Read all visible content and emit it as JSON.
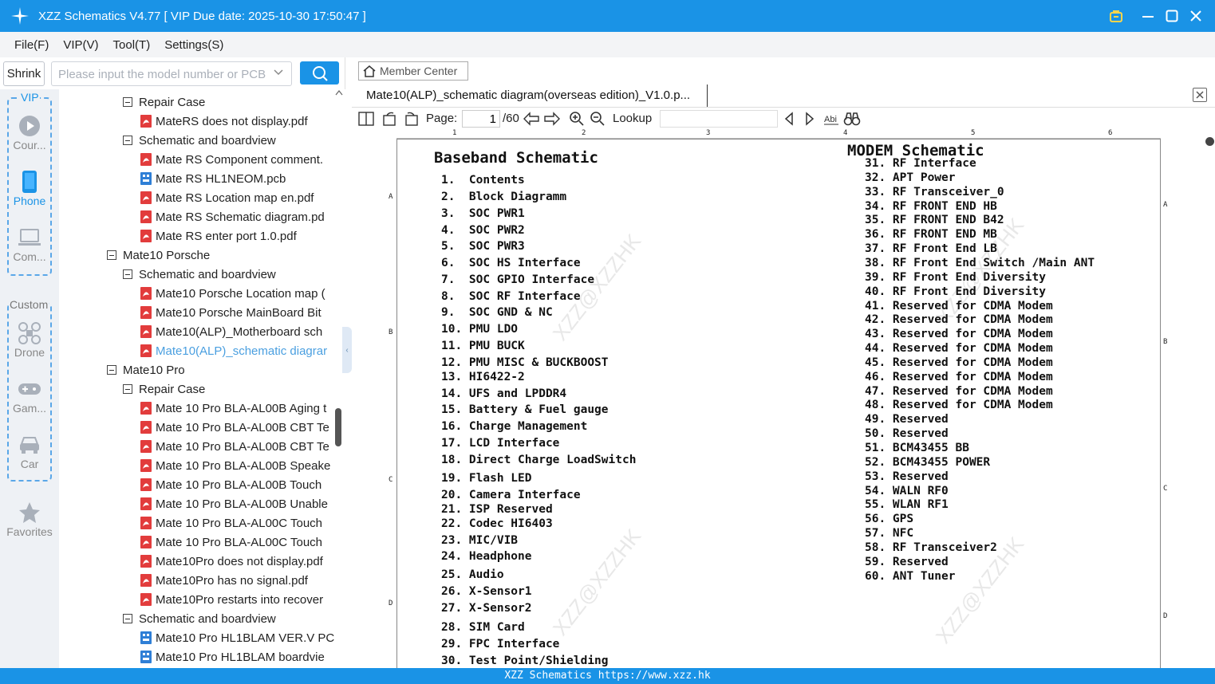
{
  "window": {
    "title": "XZZ Schematics V4.77 [ VIP Due date: 2025-10-30 17:50:47 ]"
  },
  "menu": [
    "File(F)",
    "VIP(V)",
    "Tool(T)",
    "Settings(S)"
  ],
  "left": {
    "shrink_label": "Shrink",
    "search_placeholder": "Please input the model number or PCB",
    "vip_label": "VIP",
    "custom_label": "Custom",
    "categories": [
      {
        "label": "Cour...",
        "icon": "play-icon"
      },
      {
        "label": "Phone",
        "icon": "phone-icon"
      },
      {
        "label": "Com...",
        "icon": "laptop-icon"
      },
      {
        "label": "Drone",
        "icon": "drone-icon"
      },
      {
        "label": "Gam...",
        "icon": "gamepad-icon"
      },
      {
        "label": "Car",
        "icon": "car-icon"
      },
      {
        "label": "Favorites",
        "icon": "star-icon"
      }
    ],
    "tree": [
      {
        "label": "Repair Case",
        "type": "folder",
        "level": 2
      },
      {
        "label": "MateRS does not display.pdf",
        "type": "pdf",
        "level": 3
      },
      {
        "label": "Schematic and boardview",
        "type": "folder",
        "level": 2
      },
      {
        "label": "Mate RS Component comment.",
        "type": "pdf",
        "level": 3
      },
      {
        "label": "Mate RS HL1NEOM.pcb",
        "type": "pcb",
        "level": 3
      },
      {
        "label": "Mate RS Location map en.pdf",
        "type": "pdf",
        "level": 3
      },
      {
        "label": "Mate RS Schematic diagram.pd",
        "type": "pdf",
        "level": 3
      },
      {
        "label": "Mate RS enter port 1.0.pdf",
        "type": "pdf",
        "level": 3
      },
      {
        "label": "Mate10 Porsche",
        "type": "folder",
        "level": 1
      },
      {
        "label": "Schematic and boardview",
        "type": "folder",
        "level": 2
      },
      {
        "label": "Mate10 Porsche Location map (",
        "type": "pdf",
        "level": 3
      },
      {
        "label": "Mate10 Porsche MainBoard Bit",
        "type": "pdf",
        "level": 3
      },
      {
        "label": "Mate10(ALP)_Motherboard sch",
        "type": "pdf",
        "level": 3
      },
      {
        "label": "Mate10(ALP)_schematic diagrar",
        "type": "pdf",
        "level": 3,
        "selected": true
      },
      {
        "label": "Mate10 Pro",
        "type": "folder",
        "level": 1
      },
      {
        "label": "Repair Case",
        "type": "folder",
        "level": 2
      },
      {
        "label": "Mate 10 Pro BLA-AL00B Aging t",
        "type": "pdf",
        "level": 3
      },
      {
        "label": "Mate 10 Pro BLA-AL00B CBT Te",
        "type": "pdf",
        "level": 3
      },
      {
        "label": "Mate 10 Pro BLA-AL00B CBT Te",
        "type": "pdf",
        "level": 3
      },
      {
        "label": "Mate 10 Pro BLA-AL00B Speake",
        "type": "pdf",
        "level": 3
      },
      {
        "label": "Mate 10 Pro BLA-AL00B Touch",
        "type": "pdf",
        "level": 3
      },
      {
        "label": "Mate 10 Pro BLA-AL00B Unable",
        "type": "pdf",
        "level": 3
      },
      {
        "label": "Mate 10 Pro BLA-AL00C Touch",
        "type": "pdf",
        "level": 3
      },
      {
        "label": "Mate 10 Pro BLA-AL00C Touch",
        "type": "pdf",
        "level": 3
      },
      {
        "label": "Mate10Pro does not display.pdf",
        "type": "pdf",
        "level": 3
      },
      {
        "label": "Mate10Pro has no signal.pdf",
        "type": "pdf",
        "level": 3
      },
      {
        "label": "Mate10Pro restarts into recover",
        "type": "pdf",
        "level": 3
      },
      {
        "label": "Schematic and boardview",
        "type": "folder",
        "level": 2
      },
      {
        "label": "Mate10 Pro HL1BLAM VER.V PC",
        "type": "pcb",
        "level": 3
      },
      {
        "label": "Mate10 Pro HL1BLAM boardvie",
        "type": "pcb",
        "level": 3
      }
    ]
  },
  "viewer": {
    "member_center": "Member Center",
    "tab_title": "Mate10(ALP)_schematic diagram(overseas edition)_V1.0.p...",
    "page_label": "Page:",
    "page_current": "1",
    "page_total": "/60",
    "lookup_label": "Lookup",
    "lookup_value": "",
    "ruler_cols": [
      "1",
      "2",
      "3",
      "4",
      "5",
      "6"
    ],
    "row_labels": [
      "A",
      "B",
      "C",
      "D"
    ],
    "watermark": "XZZ@XZZHK",
    "baseband": {
      "title": "Baseband Schematic",
      "items": [
        "1.  Contents",
        "2.  Block Diagramm",
        "3.  SOC PWR1",
        "4.  SOC PWR2",
        "5.  SOC PWR3",
        "6.  SOC HS Interface",
        "7.  SOC GPIO Interface",
        "8.  SOC RF Interface",
        "9.  SOC GND & NC",
        "10. PMU LDO",
        "11. PMU BUCK",
        "12. PMU MISC & BUCKBOOST",
        "13. HI6422-2",
        "14. UFS and LPDDR4",
        "15. Battery & Fuel gauge",
        "16. Charge Management",
        "17. LCD Interface",
        "18. Direct Charge LoadSwitch",
        "19. Flash LED",
        "20. Camera Interface",
        "21. ISP Reserved",
        "22. Codec HI6403",
        "23. MIC/VIB",
        "24. Headphone",
        "25. Audio",
        "26. X-Sensor1",
        "27. X-Sensor2",
        "28. SIM Card",
        "29. FPC Interface",
        "30. Test Point/Shielding"
      ]
    },
    "modem": {
      "title": "MODEM Schematic",
      "items": [
        "31. RF Interface",
        "32. APT Power",
        "33. RF Transceiver_0",
        "34. RF FRONT END HB",
        "35. RF FRONT END B42",
        "36. RF FRONT END MB",
        "37. RF Front End LB",
        "38. RF Front End Switch /Main ANT",
        "39. RF Front End Diversity",
        "40. RF Front End Diversity",
        "41. Reserved for CDMA Modem",
        "42. Reserved for CDMA Modem",
        "43. Reserved for CDMA Modem",
        "44. Reserved for CDMA Modem",
        "45. Reserved for CDMA Modem",
        "46. Reserved for CDMA Modem",
        "47. Reserved for CDMA Modem",
        "48. Reserved for CDMA Modem",
        "49. Reserved",
        "50. Reserved",
        "51. BCM43455 BB",
        "52. BCM43455 POWER",
        "53. Reserved",
        "54. WALN RF0",
        "55. WLAN RF1",
        "56. GPS",
        "57. NFC",
        "58. RF Transceiver2",
        "59. Reserved",
        "60. ANT Tuner"
      ]
    }
  },
  "footer": "XZZ Schematics https://www.xzz.hk",
  "colors": {
    "accent": "#1a93e6",
    "pdf_icon": "#e23c3c",
    "pcb_icon": "#2f7fd6",
    "selected_text": "#4a9fe0"
  }
}
